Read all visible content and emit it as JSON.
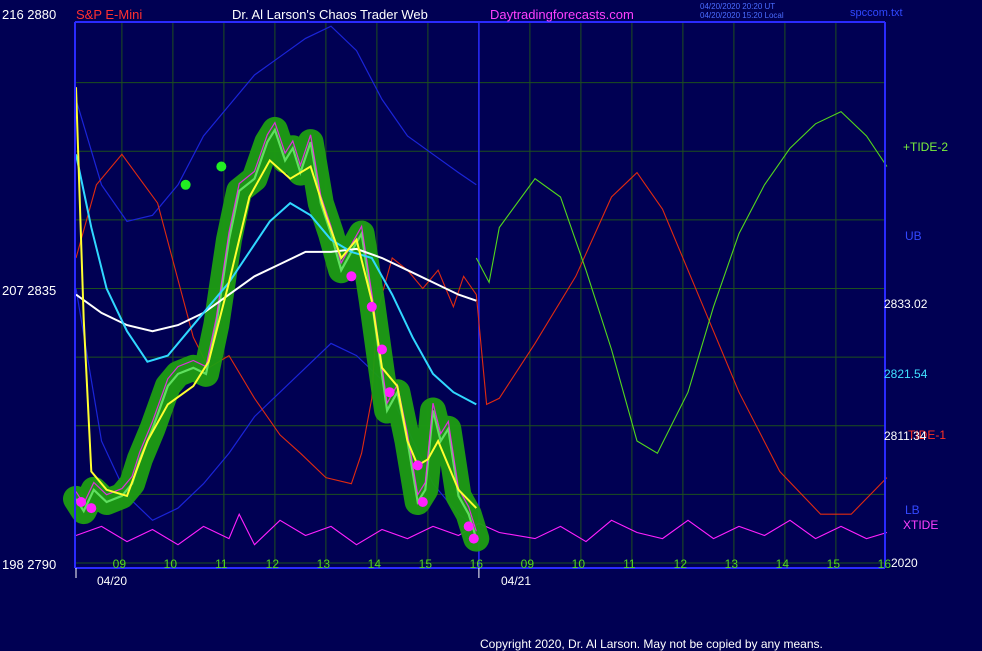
{
  "header": {
    "symbol": "S&P E-Mini",
    "title": "Dr. Al Larson's Chaos Trader Web",
    "site": "Daytradingforecasts.com",
    "stamp_utc": "04/20/2020 20:20 UT",
    "stamp_local": "04/20/2020 15:20 Local",
    "file": "spccom.txt"
  },
  "copyright": "Copyright 2020, Dr. Al Larson. May not be copied by any means.",
  "colors": {
    "background": "#000053",
    "grid": "#1d4f1d",
    "axis": "#2a2aff",
    "price": "#5fe05f",
    "glow": "#1e9d12",
    "magenta": "#ff20ff",
    "yellow": "#ffff30",
    "cyan": "#30d8ff",
    "white": "#ffffff",
    "red": "#e02a10",
    "tide2": "#52d81c",
    "band": "#1a24d8"
  },
  "chart_data": {
    "type": "line",
    "title": "S&P E-Mini",
    "y_left_ticks": [
      {
        "label": "216  2880",
        "price": 2880
      },
      {
        "label": "207  2835",
        "price": 2835
      },
      {
        "label": "198  2790",
        "price": 2790
      }
    ],
    "ylim": [
      2790,
      2880
    ],
    "hour_labels_day1": [
      "09",
      "10",
      "11",
      "12",
      "13",
      "14",
      "15",
      "16"
    ],
    "hour_labels_day2": [
      "09",
      "10",
      "11",
      "12",
      "13",
      "14",
      "15",
      "16"
    ],
    "date_labels": [
      "04/20",
      "04/21"
    ],
    "last_values": [
      {
        "label": "2833.02",
        "series": "white_avg",
        "value": 2833.02
      },
      {
        "label": "2821.54",
        "series": "cyan_avg",
        "value": 2821.54
      },
      {
        "label": "2811.34",
        "series": "yellow_avg",
        "value": 2811.34
      }
    ],
    "right_labels": {
      "tide2": "+TIDE-2",
      "ub": "UB",
      "tide1": "TIDE-1",
      "lb": "LB",
      "xtide": "XTIDE",
      "year": "2020"
    },
    "series": [
      {
        "name": "Price",
        "x": [
          0,
          0.15,
          0.35,
          0.6,
          0.9,
          1.1,
          1.25,
          1.5,
          1.8,
          2.0,
          2.3,
          2.55,
          2.75,
          3.0,
          3.2,
          3.5,
          3.75,
          3.9,
          4.1,
          4.25,
          4.4,
          4.6,
          4.8,
          5.0,
          5.2,
          5.4,
          5.6,
          5.8,
          5.95,
          6.1,
          6.3,
          6.5,
          6.7,
          6.85,
          7.0,
          7.15,
          7.3,
          7.5,
          7.7,
          7.85
        ],
        "y": [
          2800.5,
          2798.5,
          2802,
          2800,
          2801,
          2803,
          2807,
          2812,
          2819,
          2821,
          2822,
          2821,
          2829,
          2843,
          2851,
          2853,
          2859,
          2861,
          2856,
          2858,
          2854,
          2859,
          2849,
          2844,
          2838,
          2841,
          2844,
          2833,
          2824,
          2815,
          2818,
          2810,
          2800,
          2802,
          2815,
          2810,
          2812,
          2801,
          2798,
          2794
        ]
      },
      {
        "name": "yellow_avg",
        "x": [
          0,
          0.15,
          0.3,
          0.6,
          1.0,
          1.4,
          1.8,
          2.3,
          2.6,
          3.0,
          3.4,
          3.8,
          4.2,
          4.6,
          4.9,
          5.2,
          5.5,
          5.8,
          6.0,
          6.3,
          6.5,
          6.7,
          6.9,
          7.1,
          7.3,
          7.5,
          7.85
        ],
        "y": [
          2868,
          2830,
          2805,
          2802,
          2801,
          2810,
          2816,
          2819,
          2823,
          2836,
          2850,
          2856,
          2853,
          2855,
          2847,
          2840,
          2843,
          2833,
          2822,
          2819,
          2810,
          2806,
          2807,
          2810,
          2806,
          2802,
          2799
        ]
      },
      {
        "name": "cyan_avg",
        "x": [
          0,
          0.3,
          0.6,
          1.0,
          1.4,
          1.8,
          2.2,
          2.6,
          3.0,
          3.4,
          3.8,
          4.2,
          4.6,
          5.0,
          5.4,
          5.8,
          6.2,
          6.6,
          7.0,
          7.4,
          7.85
        ],
        "y": [
          2857,
          2845,
          2835,
          2828,
          2823,
          2824,
          2828,
          2832,
          2836,
          2841,
          2846,
          2849,
          2847,
          2843,
          2841,
          2840,
          2834,
          2827,
          2821,
          2818,
          2816
        ]
      },
      {
        "name": "white_avg",
        "x": [
          0,
          0.5,
          1.0,
          1.5,
          2.0,
          2.5,
          3.0,
          3.5,
          4.0,
          4.5,
          5.0,
          5.5,
          6.0,
          6.5,
          7.0,
          7.5,
          7.85
        ],
        "y": [
          2834,
          2831,
          2829,
          2828,
          2829,
          2831,
          2834,
          2837,
          2839,
          2841,
          2841,
          2841.5,
          2840,
          2838,
          2836,
          2834,
          2833
        ]
      },
      {
        "name": "upper_band",
        "x": [
          0,
          0.5,
          1.0,
          1.5,
          2.0,
          2.5,
          3.0,
          3.5,
          4.0,
          4.5,
          5.0,
          5.5,
          6.0,
          6.5,
          7.0,
          7.5,
          7.85
        ],
        "y": [
          2866,
          2852,
          2846,
          2847,
          2852,
          2860,
          2865,
          2870,
          2873,
          2876,
          2878,
          2874,
          2866,
          2860,
          2857,
          2854,
          2852
        ]
      },
      {
        "name": "lower_band",
        "x": [
          0,
          0.5,
          1.0,
          1.5,
          2.0,
          2.5,
          3.0,
          3.5,
          4.0,
          4.5,
          5.0,
          5.5,
          6.0,
          6.5,
          7.0,
          7.5,
          7.85
        ],
        "y": [
          2835,
          2810,
          2801,
          2797,
          2799,
          2803,
          2808,
          2814,
          2818,
          2822,
          2826,
          2824,
          2820,
          2812,
          2803,
          2798,
          2796
        ]
      },
      {
        "name": "tide1",
        "x": [
          0,
          0.4,
          0.9,
          1.6,
          2.3,
          2.6,
          3.0,
          3.5,
          4.0,
          4.4,
          4.9,
          5.4,
          5.6,
          5.8,
          5.9,
          6.2,
          6.5,
          6.8,
          7.1,
          7.4,
          7.6,
          7.85,
          8.05,
          8.3,
          9.0,
          9.8,
          10.5,
          11.0,
          11.5,
          12.2,
          13.0,
          13.8,
          14.6,
          15.2,
          15.9
        ],
        "y": [
          2840,
          2852,
          2857,
          2849,
          2827,
          2822,
          2824,
          2817,
          2811,
          2808,
          2804,
          2803,
          2808,
          2817,
          2831,
          2840,
          2838,
          2835,
          2838,
          2832,
          2837,
          2834,
          2816,
          2817,
          2826,
          2837,
          2850,
          2854,
          2848,
          2834,
          2818,
          2805,
          2798,
          2798,
          2804
        ]
      },
      {
        "name": "tide2",
        "x": [
          7.85,
          8.1,
          8.3,
          9.0,
          9.5,
          10.0,
          10.5,
          11.0,
          11.4,
          12.0,
          12.5,
          13.0,
          13.5,
          14.0,
          14.5,
          15.0,
          15.5,
          15.9
        ],
        "y": [
          2840,
          2836,
          2845,
          2853,
          2850,
          2838,
          2825,
          2810,
          2808,
          2818,
          2832,
          2844,
          2852,
          2858,
          2862,
          2864,
          2860,
          2855
        ]
      },
      {
        "name": "xtide",
        "x": [
          0,
          0.5,
          1.0,
          1.5,
          2.0,
          2.5,
          3.0,
          3.2,
          3.5,
          4.0,
          4.5,
          5.0,
          5.5,
          6.0,
          6.5,
          7.0,
          7.5,
          7.9,
          8.3,
          9.0,
          9.5,
          10.0,
          10.5,
          11.0,
          11.5,
          12.0,
          12.5,
          13.0,
          13.5,
          14.0,
          14.5,
          15.0,
          15.5,
          15.9
        ],
        "y": [
          2794.5,
          2796,
          2793.5,
          2795.5,
          2793,
          2796,
          2794,
          2798,
          2793,
          2797,
          2794.5,
          2796,
          2793,
          2795.5,
          2794,
          2796,
          2794.5,
          2796.5,
          2795,
          2794,
          2796,
          2793.5,
          2797,
          2795,
          2794,
          2797,
          2794,
          2796,
          2794.5,
          2797,
          2794,
          2796,
          2794,
          2795
        ]
      }
    ],
    "pivots_green": [
      {
        "x": 2.15,
        "y": 2852
      },
      {
        "x": 2.85,
        "y": 2855
      }
    ],
    "pivots_magenta": [
      {
        "x": 0.1,
        "y": 2800
      },
      {
        "x": 0.3,
        "y": 2799
      },
      {
        "x": 5.4,
        "y": 2837
      },
      {
        "x": 5.8,
        "y": 2832
      },
      {
        "x": 6.0,
        "y": 2825
      },
      {
        "x": 6.15,
        "y": 2818
      },
      {
        "x": 6.7,
        "y": 2806
      },
      {
        "x": 6.8,
        "y": 2800
      },
      {
        "x": 7.7,
        "y": 2796
      },
      {
        "x": 7.8,
        "y": 2794
      }
    ]
  }
}
